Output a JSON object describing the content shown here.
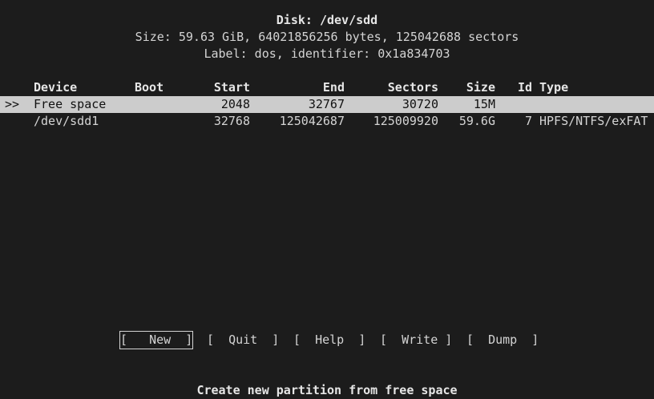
{
  "header": {
    "disk_line": "Disk: /dev/sdd",
    "size_line": "Size: 59.63 GiB, 64021856256 bytes, 125042688 sectors",
    "label_line": "Label: dos, identifier: 0x1a834703"
  },
  "table": {
    "columns": {
      "device": "Device",
      "boot": "Boot",
      "start": "Start",
      "end": "End",
      "sectors": "Sectors",
      "size": "Size",
      "id": "Id",
      "type": "Type"
    },
    "rows": [
      {
        "cursor": ">>",
        "device": "Free space",
        "boot": "",
        "start": "2048",
        "end": "32767",
        "sectors": "30720",
        "size": "15M",
        "id": "",
        "type": ""
      },
      {
        "cursor": "",
        "device": "/dev/sdd1",
        "boot": "",
        "start": "32768",
        "end": "125042687",
        "sectors": "125009920",
        "size": "59.6G",
        "id": "7",
        "type": "HPFS/NTFS/exFAT"
      }
    ]
  },
  "menu": {
    "new": "[   New  ]",
    "quit": "[  Quit  ]",
    "help": "[  Help  ]",
    "write": "[  Write ]",
    "dump": "[  Dump  ]"
  },
  "status": {
    "hint": "Create new partition from free space"
  }
}
